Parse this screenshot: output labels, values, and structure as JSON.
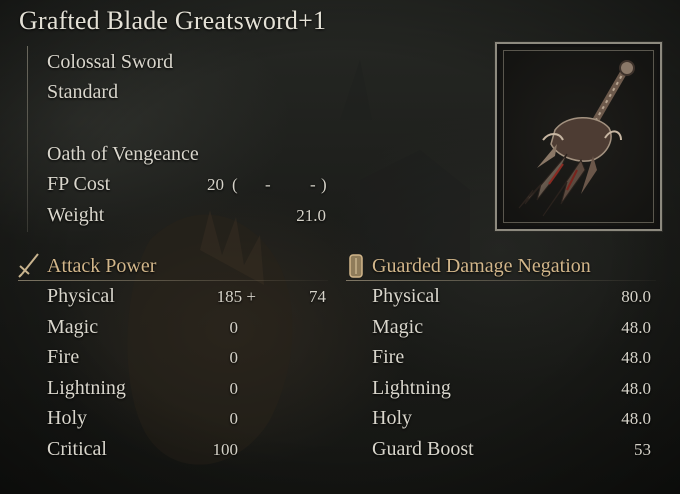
{
  "item": {
    "name": "Grafted Blade Greatsword+1",
    "weapon_type": "Colossal Sword",
    "affinity": "Standard",
    "skill_name": "Oath of Vengeance",
    "fp_cost": {
      "label": "FP Cost",
      "value": "20",
      "open_paren": "(",
      "dash_1": "-",
      "dash_2": "-",
      "close_paren": ")"
    },
    "weight": {
      "label": "Weight",
      "value": "21.0"
    },
    "icon": "grafted-greatsword-icon"
  },
  "attack_power": {
    "title": "Attack Power",
    "icon": "sword-icon",
    "rows": [
      {
        "label": "Physical",
        "value": "185 +",
        "bonus": "74"
      },
      {
        "label": "Magic",
        "value": "0"
      },
      {
        "label": "Fire",
        "value": "0"
      },
      {
        "label": "Lightning",
        "value": "0"
      },
      {
        "label": "Holy",
        "value": "0"
      },
      {
        "label": "Critical",
        "value": "100"
      }
    ]
  },
  "guard": {
    "title": "Guarded Damage Negation",
    "icon": "shield-icon",
    "rows": [
      {
        "label": "Physical",
        "value": "80.0"
      },
      {
        "label": "Magic",
        "value": "48.0"
      },
      {
        "label": "Fire",
        "value": "48.0"
      },
      {
        "label": "Lightning",
        "value": "48.0"
      },
      {
        "label": "Holy",
        "value": "48.0"
      },
      {
        "label": "Guard Boost",
        "value": "53"
      }
    ]
  },
  "colors": {
    "section_title": "#d2b68a",
    "text": "#d9d6cc",
    "frame": "#8d8a7f"
  }
}
